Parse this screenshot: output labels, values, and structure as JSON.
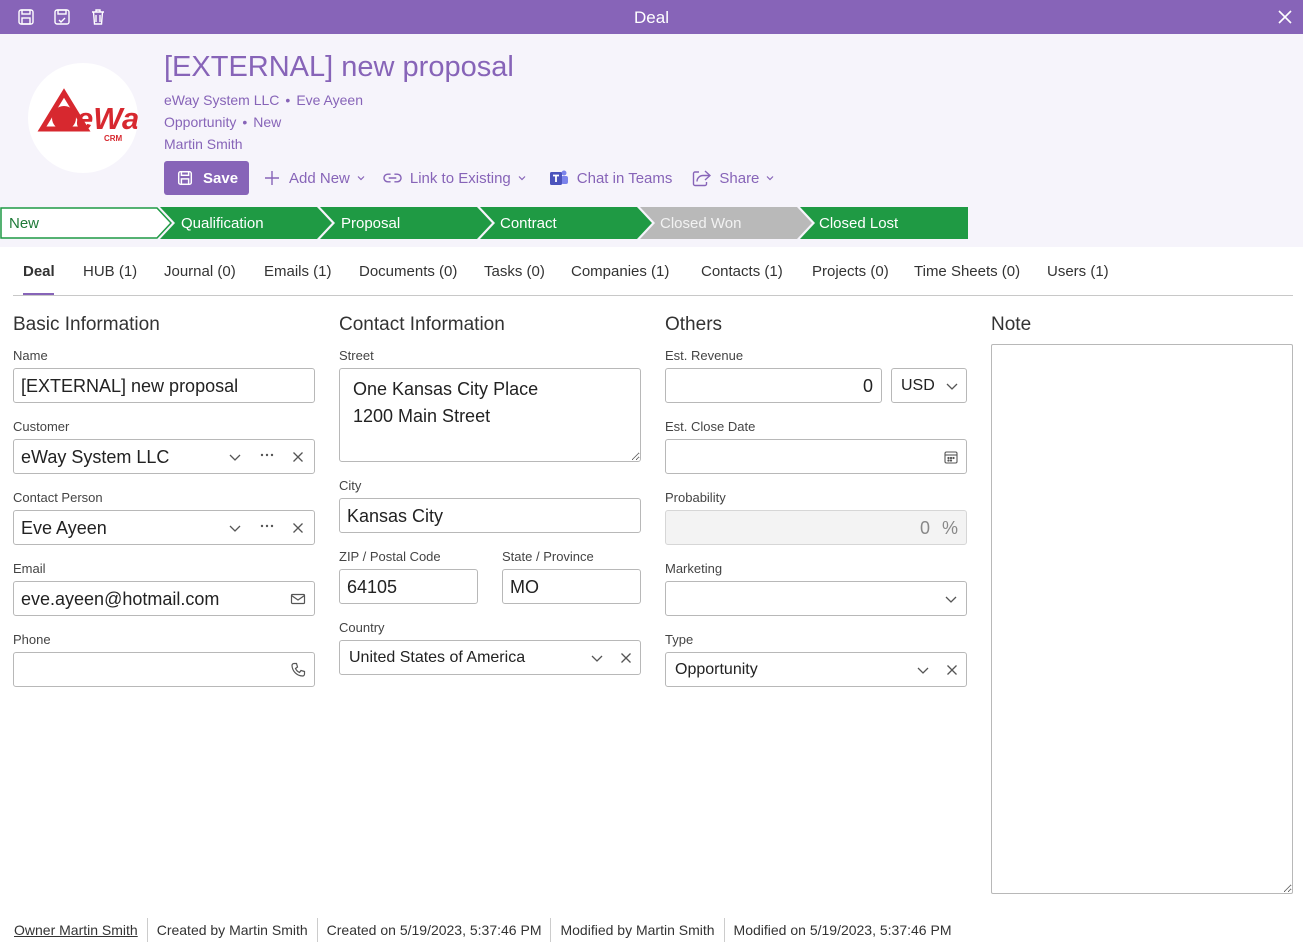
{
  "window": {
    "title": "Deal"
  },
  "deal": {
    "title": "[EXTERNAL] new proposal",
    "company": "eWay System LLC",
    "contact": "Eve Ayeen",
    "type": "Opportunity",
    "status": "New",
    "owner": "Martin Smith",
    "logo_text": "eWay",
    "logo_sub": "CRM"
  },
  "toolbar": {
    "save": "Save",
    "add_new": "Add New",
    "link_existing": "Link to Existing",
    "chat_teams": "Chat in Teams",
    "share": "Share"
  },
  "stages": [
    {
      "label": "New",
      "state": "current"
    },
    {
      "label": "Qualification",
      "state": "done"
    },
    {
      "label": "Proposal",
      "state": "done"
    },
    {
      "label": "Contract",
      "state": "done"
    },
    {
      "label": "Closed Won",
      "state": "disabled"
    },
    {
      "label": "Closed Lost",
      "state": "done"
    }
  ],
  "tabs": [
    "Deal",
    "HUB (1)",
    "Journal (0)",
    "Emails (1)",
    "Documents (0)",
    "Tasks (0)",
    "Companies (1)",
    "Contacts (1)",
    "Projects (0)",
    "Time Sheets (0)",
    "Users (1)"
  ],
  "basic": {
    "heading": "Basic Information",
    "name_label": "Name",
    "name_value": "[EXTERNAL] new proposal",
    "customer_label": "Customer",
    "customer_value": "eWay System LLC",
    "contact_label": "Contact Person",
    "contact_value": "Eve Ayeen",
    "email_label": "Email",
    "email_value": "eve.ayeen@hotmail.com",
    "phone_label": "Phone",
    "phone_value": ""
  },
  "contact_info": {
    "heading": "Contact Information",
    "street_label": "Street",
    "street_value": "One Kansas City Place\n1200 Main Street",
    "city_label": "City",
    "city_value": "Kansas City",
    "zip_label": "ZIP / Postal Code",
    "zip_value": "64105",
    "state_label": "State / Province",
    "state_value": "MO",
    "country_label": "Country",
    "country_value": "United States of America"
  },
  "others": {
    "heading": "Others",
    "revenue_label": "Est. Revenue",
    "revenue_value": "0",
    "currency_value": "USD",
    "close_date_label": "Est. Close Date",
    "close_date_value": "",
    "probability_label": "Probability",
    "probability_value": "0",
    "probability_unit": "%",
    "marketing_label": "Marketing",
    "marketing_value": "",
    "type_label": "Type",
    "type_value": "Opportunity"
  },
  "note": {
    "heading": "Note",
    "value": ""
  },
  "footer": {
    "owner": "Owner Martin Smith",
    "created_by": "Created by Martin Smith",
    "created_on": "Created on 5/19/2023, 5:37:46 PM",
    "modified_by": "Modified by Martin Smith",
    "modified_on": "Modified on 5/19/2023, 5:37:46 PM"
  },
  "colors": {
    "accent": "#8764b8",
    "stage_done": "#1f9a44",
    "stage_disabled": "#b9b9b9",
    "header_bg": "#f6f4fb"
  }
}
